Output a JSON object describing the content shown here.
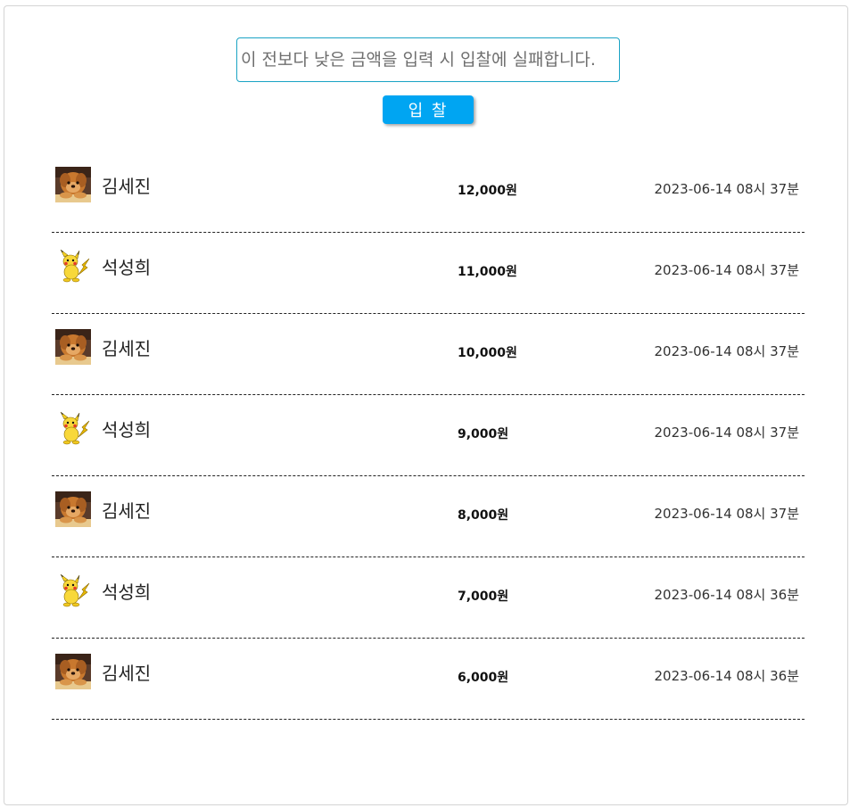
{
  "bid_form": {
    "input_placeholder": "이 전보다 낮은 금액을 입력 시 입찰에 실패합니다.",
    "input_value": "",
    "button_label": "입 찰",
    "accent_color": "#00a5f2",
    "input_border_color": "#1aa3c4"
  },
  "bids": [
    {
      "avatar": "dog-photo-avatar",
      "name": "김세진",
      "amount": "12,000원",
      "time": "2023-06-14 08시 37분"
    },
    {
      "avatar": "pikachu-avatar",
      "name": "석성희",
      "amount": "11,000원",
      "time": "2023-06-14 08시 37분"
    },
    {
      "avatar": "dog-photo-avatar",
      "name": "김세진",
      "amount": "10,000원",
      "time": "2023-06-14 08시 37분"
    },
    {
      "avatar": "pikachu-avatar",
      "name": "석성희",
      "amount": "9,000원",
      "time": "2023-06-14 08시 37분"
    },
    {
      "avatar": "dog-photo-avatar",
      "name": "김세진",
      "amount": "8,000원",
      "time": "2023-06-14 08시 37분"
    },
    {
      "avatar": "pikachu-avatar",
      "name": "석성희",
      "amount": "7,000원",
      "time": "2023-06-14 08시 36분"
    },
    {
      "avatar": "dog-photo-avatar",
      "name": "김세진",
      "amount": "6,000원",
      "time": "2023-06-14 08시 36분"
    }
  ]
}
